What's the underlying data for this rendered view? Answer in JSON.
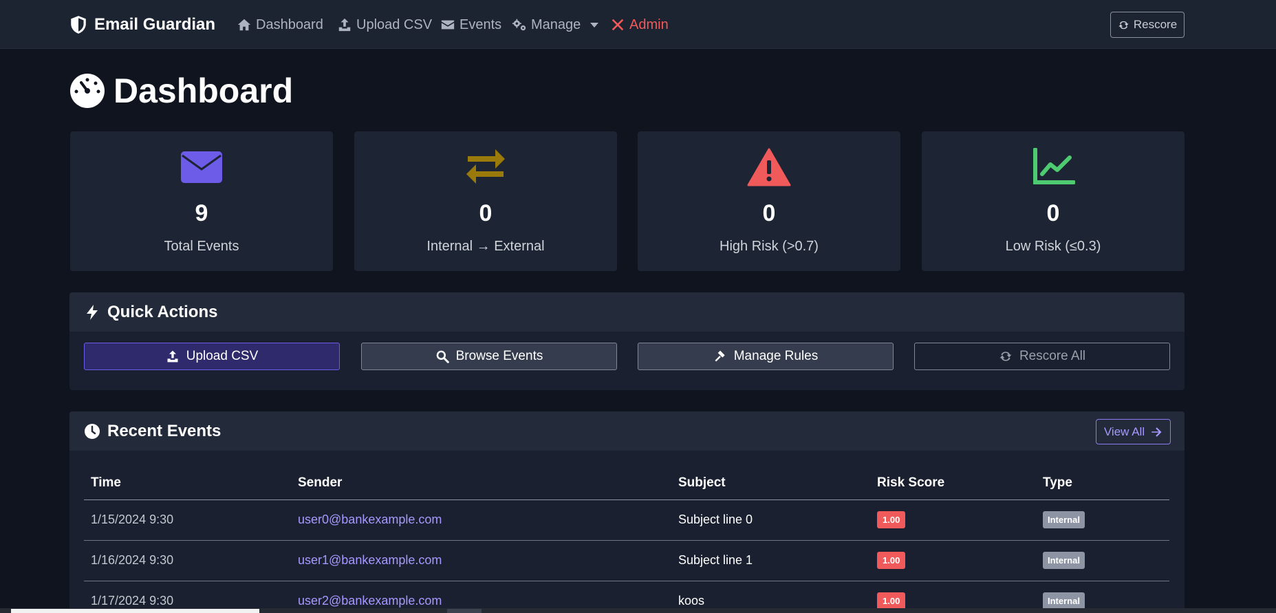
{
  "navbar": {
    "brand": "Email Guardian",
    "items": [
      {
        "label": "Dashboard",
        "icon": "home-icon"
      },
      {
        "label": "Upload CSV",
        "icon": "upload-icon"
      },
      {
        "label": "Events",
        "icon": "envelope-icon"
      },
      {
        "label": "Manage",
        "icon": "cogs-icon"
      },
      {
        "label": "Admin",
        "icon": "tools-icon"
      }
    ],
    "rescore_label": "Rescore"
  },
  "page": {
    "title": "Dashboard"
  },
  "stats": [
    {
      "value": "9",
      "label": "Total Events",
      "icon": "envelope-icon",
      "color": "#6c5ce7"
    },
    {
      "value": "0",
      "label": "Internal → External",
      "icon": "exchange-icon",
      "color": "#9a7a0a"
    },
    {
      "value": "0",
      "label": "High Risk (>0.7)",
      "icon": "warning-icon",
      "color": "#f05a5a"
    },
    {
      "value": "0",
      "label": "Low Risk (≤0.3)",
      "icon": "chart-line-icon",
      "color": "#4ecb71"
    }
  ],
  "quick_actions": {
    "title": "Quick Actions",
    "buttons": [
      {
        "label": "Upload CSV"
      },
      {
        "label": "Browse Events"
      },
      {
        "label": "Manage Rules"
      },
      {
        "label": "Rescore All"
      }
    ]
  },
  "recent_events": {
    "title": "Recent Events",
    "view_all": "View All",
    "columns": [
      "Time",
      "Sender",
      "Subject",
      "Risk Score",
      "Type"
    ],
    "rows": [
      {
        "time": "1/15/2024 9:30",
        "sender": "user0@bankexample.com",
        "subject": "Subject line 0",
        "risk": "1.00",
        "type": "Internal"
      },
      {
        "time": "1/16/2024 9:30",
        "sender": "user1@bankexample.com",
        "subject": "Subject line 1",
        "risk": "1.00",
        "type": "Internal"
      },
      {
        "time": "1/17/2024 9:30",
        "sender": "user2@bankexample.com",
        "subject": "koos",
        "risk": "1.00",
        "type": "Internal"
      }
    ]
  }
}
